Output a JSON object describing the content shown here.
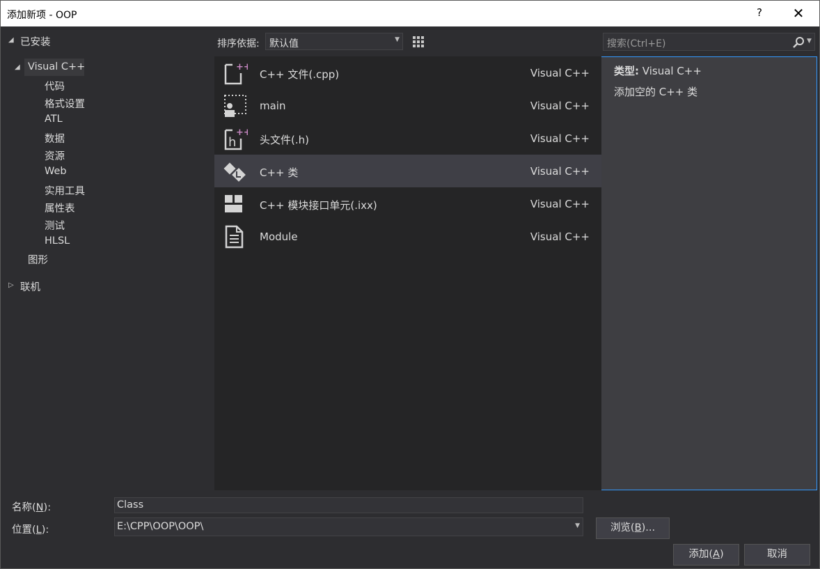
{
  "window": {
    "title": "添加新项 - OOP",
    "help_glyph": "?",
    "close_glyph": "✕"
  },
  "tree": {
    "installed": "已安装",
    "visual_cpp": "Visual C++",
    "children": [
      "代码",
      "格式设置",
      "ATL",
      "数据",
      "资源",
      "Web",
      "实用工具",
      "属性表",
      "测试",
      "HLSL"
    ],
    "graphics": "图形",
    "online": "联机"
  },
  "toolbar": {
    "sort_label": "排序依据:",
    "sort_value": "默认值"
  },
  "search": {
    "placeholder": "搜索(Ctrl+E)"
  },
  "templates": [
    {
      "name": "C++ 文件(.cpp)",
      "lang": "Visual C++",
      "icon": "cpp-file-icon"
    },
    {
      "name": "main",
      "lang": "Visual C++",
      "icon": "main-icon"
    },
    {
      "name": "头文件(.h)",
      "lang": "Visual C++",
      "icon": "header-file-icon"
    },
    {
      "name": "C++ 类",
      "lang": "Visual C++",
      "icon": "cpp-class-icon",
      "selected": true
    },
    {
      "name": "C++ 模块接口单元(.ixx)",
      "lang": "Visual C++",
      "icon": "module-interface-icon"
    },
    {
      "name": "Module",
      "lang": "Visual C++",
      "icon": "module-icon"
    }
  ],
  "details": {
    "type_label": "类型:",
    "type_value": "Visual C++",
    "description": "添加空的 C++ 类"
  },
  "form": {
    "name_label_pre": "名称(",
    "name_label_key": "N",
    "name_label_post": "):",
    "name_value": "Class",
    "location_label_pre": "位置(",
    "location_label_key": "L",
    "location_label_post": "):",
    "location_value": "E:\\CPP\\OOP\\OOP\\",
    "browse_pre": "浏览(",
    "browse_key": "B",
    "browse_post": ")...",
    "add_pre": "添加(",
    "add_key": "A",
    "add_post": ")",
    "cancel": "取消"
  },
  "colors": {
    "accent": "#3399ff",
    "plus_accent": "#c586c0",
    "background": "#2d2d30",
    "list_bg": "#252526",
    "selected_row": "#3f3f46"
  }
}
